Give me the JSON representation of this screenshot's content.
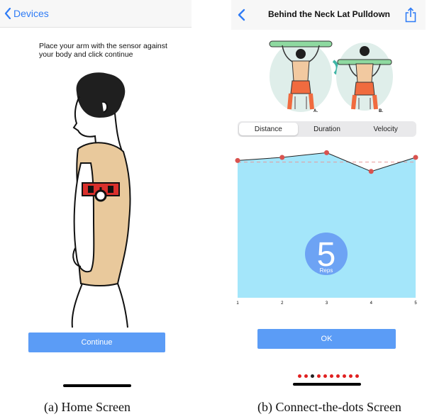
{
  "home_screen": {
    "nav": {
      "back_label": "Devices"
    },
    "instruction": "Place your arm with the sensor against your body and click continue",
    "continue_label": "Continue"
  },
  "connect_screen": {
    "nav": {
      "title": "Behind the Neck Lat Pulldown"
    },
    "illustration_labels": [
      "A.",
      "B."
    ],
    "tabs": [
      {
        "label": "Distance",
        "selected": true
      },
      {
        "label": "Duration",
        "selected": false
      },
      {
        "label": "Velocity",
        "selected": false
      }
    ],
    "reps": {
      "count": "5",
      "label": "Reps"
    },
    "ok_label": "OK",
    "page_dots": {
      "count": 10,
      "active_index": 2
    }
  },
  "captions": {
    "a": "(a) Home Screen",
    "b": "(b) Connect-the-dots Screen"
  },
  "colors": {
    "accent": "#2f7cf6",
    "button": "#5b9cf6",
    "chart_fill": "#a4e6fa",
    "point": "#d9534f",
    "rep_circle": "#6da3f4",
    "dot_inactive": "#e02020",
    "sensor": "#d9302c",
    "vest": "#e9c99c"
  },
  "chart_data": {
    "type": "area",
    "x": [
      1,
      2,
      3,
      4,
      5
    ],
    "values": [
      0.88,
      0.9,
      0.93,
      0.81,
      0.9
    ],
    "reference_line": 0.87,
    "ylim": [
      0,
      1
    ],
    "xlabel": "",
    "ylabel": ""
  }
}
